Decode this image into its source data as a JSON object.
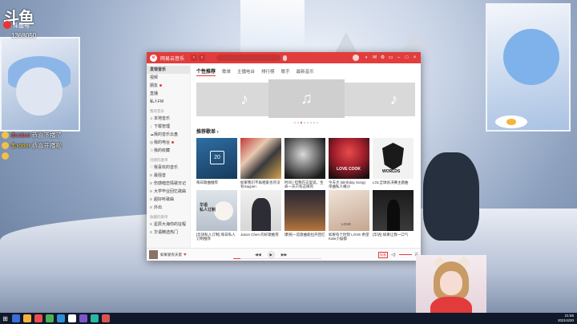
{
  "stream": {
    "logo_text": "斗鱼",
    "logo_sub": "斗鱼号",
    "room_id": "1368050",
    "chat": [
      {
        "user": "本robot",
        "text": "恭喜下播了",
        "color": "red"
      },
      {
        "user": "本robot",
        "text": "恭喜开播啦",
        "color": "yellow"
      },
      {
        "user": "",
        "text": "",
        "color": "pink"
      }
    ]
  },
  "app": {
    "name": "网易云音乐",
    "logo": "e",
    "user_name": "",
    "tabs": [
      "个性推荐",
      "歌单",
      "主播电台",
      "排行榜",
      "歌手",
      "最新音乐"
    ],
    "active_tab": 0,
    "banner_tag": "",
    "section_title": "推荐歌单",
    "sidebar": {
      "items": [
        {
          "label": "发现音乐",
          "active": true,
          "icon": ""
        },
        {
          "label": "视频",
          "icon": ""
        },
        {
          "label": "朋友",
          "icon": "",
          "dot": true
        },
        {
          "label": "直播",
          "icon": ""
        },
        {
          "label": "私人FM",
          "icon": ""
        }
      ],
      "my_music_head": "我的音乐",
      "my_music": [
        {
          "label": "本地音乐",
          "icon": "♫"
        },
        {
          "label": "下载管理",
          "icon": "↓"
        },
        {
          "label": "我的音乐云盘",
          "icon": "☁"
        },
        {
          "label": "我的电台",
          "icon": "◎",
          "dot": true
        },
        {
          "label": "我的收藏",
          "icon": "☆"
        }
      ],
      "created_head": "创建的歌单",
      "created": [
        {
          "label": "我喜欢的音乐",
          "icon": "♡"
        },
        {
          "label": "最强音",
          "icon": "≡"
        },
        {
          "label": "伤感暗恋情歌日记",
          "icon": "≡"
        },
        {
          "label": "大学毕业回忆歌曲",
          "icon": "≡"
        },
        {
          "label": "超好听歌曲",
          "icon": "≡"
        },
        {
          "label": "外出",
          "icon": "≡"
        }
      ],
      "collected_head": "收藏的歌单",
      "collected": [
        {
          "label": "星辰大海你的征程",
          "icon": "≡"
        },
        {
          "label": "华语精选热门",
          "icon": "≡"
        }
      ]
    },
    "playlists": [
      {
        "caption": "每日歌曲推荐"
      },
      {
        "caption": "如果我们不再相爱也许没有Saypen"
      },
      {
        "caption": "时间 | 但我在这里说，生命一天只有这样的"
      },
      {
        "caption": "今天大 (Birthday Song) 单曲私人横沙"
      },
      {
        "caption": "LOL全球总决赛主题曲"
      },
      {
        "caption": "[华语私人订制] 每日私人订制推荐"
      },
      {
        "caption": "Jason Chen 的好歌推荐"
      },
      {
        "caption": "爆哭|一首歌曲能拉开回忆"
      },
      {
        "caption": "如果有个时刻 LOVE 希望 Kate小猫都"
      },
      {
        "caption": "[华语] 如果让我一口气"
      }
    ],
    "player": {
      "track": "如果爱有天意",
      "controls": [
        "◀◀",
        "▶",
        "▶▶"
      ],
      "badge": "标准",
      "progress_fraction": 0.08
    }
  },
  "taskbar": {
    "time": "21:56",
    "date": "2021/4/20"
  }
}
